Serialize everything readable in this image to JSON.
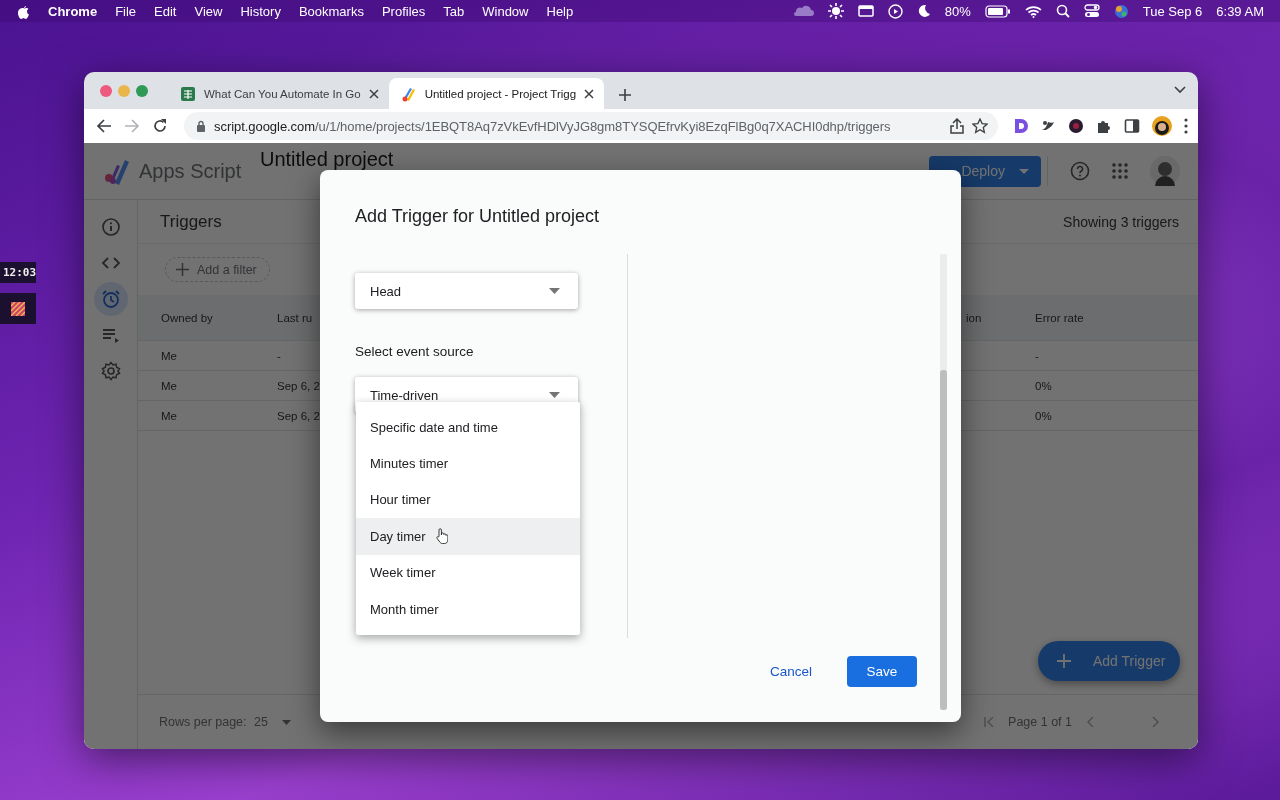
{
  "menu_bar": {
    "app": "Chrome",
    "menus": [
      "File",
      "Edit",
      "View",
      "History",
      "Bookmarks",
      "Profiles",
      "Tab",
      "Window",
      "Help"
    ],
    "battery": "80%",
    "date": "Tue Sep 6",
    "time": "6:39 AM"
  },
  "desktop_widget": {
    "clock": "12:03"
  },
  "browser": {
    "tabs": [
      {
        "title": "What Can You Automate In Go",
        "selected": false
      },
      {
        "title": "Untitled project - Project Trigg",
        "selected": true
      }
    ],
    "url": {
      "host": "script.google.com",
      "path": "/u/1/home/projects/1EBQT8Aq7zVkEvfHDlVyJG8gm8TYSQEfrvKyi8EzqFlBg0q7XACHI0dhp/triggers"
    }
  },
  "app": {
    "product": "Apps Script",
    "project": "Untitled project",
    "deploy": "Deploy",
    "rail": [
      {
        "kind": "info",
        "selected": false
      },
      {
        "kind": "code",
        "selected": false
      },
      {
        "kind": "clock",
        "selected": true
      },
      {
        "kind": "executions",
        "selected": false
      },
      {
        "kind": "settings",
        "selected": false
      }
    ],
    "page_title": "Triggers",
    "count": "Showing 3 triggers",
    "filter": "Add a filter",
    "table": {
      "columns": [
        "Owned by",
        "Last ru",
        "ion",
        "Error rate"
      ],
      "rows": [
        {
          "owned_by": "Me",
          "last_run": "-",
          "error_rate": "-"
        },
        {
          "owned_by": "Me",
          "last_run": "Sep 6, 2",
          "error_rate": "0%"
        },
        {
          "owned_by": "Me",
          "last_run": "Sep 6, 2",
          "error_rate": "0%"
        }
      ]
    },
    "rows_per_page_label": "Rows per page:",
    "rows_per_page": "25",
    "pagination": "Page 1 of 1",
    "fab": "Add Trigger"
  },
  "dialog": {
    "title": "Add Trigger for Untitled project",
    "deployment_value": "Head",
    "event_source_label": "Select event source",
    "event_source_value": "Time-driven",
    "event_menu": [
      {
        "label": "Specific date and time",
        "selected": false
      },
      {
        "label": "Minutes timer",
        "selected": false
      },
      {
        "label": "Hour timer",
        "selected": false
      },
      {
        "label": "Day timer",
        "selected": true
      },
      {
        "label": "Week timer",
        "selected": false
      },
      {
        "label": "Month timer",
        "selected": false
      }
    ],
    "buttons": [
      {
        "label": "Cancel",
        "kind": "text"
      },
      {
        "label": "Save",
        "kind": "primary"
      }
    ]
  }
}
